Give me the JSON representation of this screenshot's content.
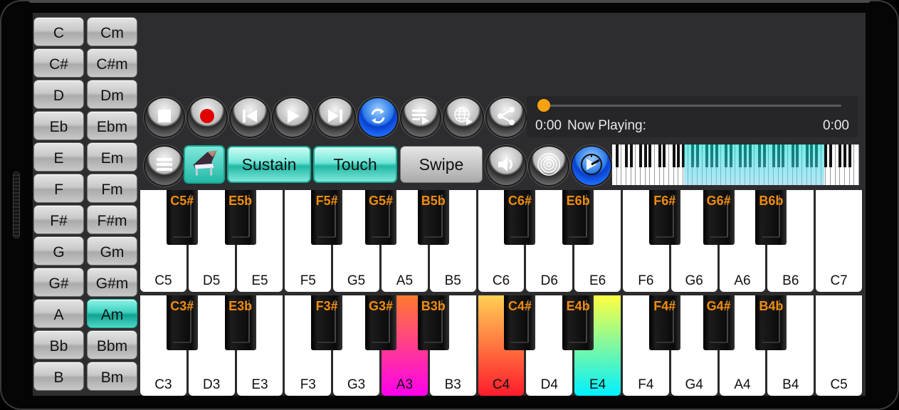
{
  "chords": [
    {
      "label": "C",
      "active": false
    },
    {
      "label": "Cm",
      "active": false
    },
    {
      "label": "C#",
      "active": false
    },
    {
      "label": "C#m",
      "active": false
    },
    {
      "label": "D",
      "active": false
    },
    {
      "label": "Dm",
      "active": false
    },
    {
      "label": "Eb",
      "active": false
    },
    {
      "label": "Ebm",
      "active": false
    },
    {
      "label": "E",
      "active": false
    },
    {
      "label": "Em",
      "active": false
    },
    {
      "label": "F",
      "active": false
    },
    {
      "label": "Fm",
      "active": false
    },
    {
      "label": "F#",
      "active": false
    },
    {
      "label": "F#m",
      "active": false
    },
    {
      "label": "G",
      "active": false
    },
    {
      "label": "Gm",
      "active": false
    },
    {
      "label": "G#",
      "active": false
    },
    {
      "label": "G#m",
      "active": false
    },
    {
      "label": "A",
      "active": false
    },
    {
      "label": "Am",
      "active": true
    },
    {
      "label": "Bb",
      "active": false
    },
    {
      "label": "Bbm",
      "active": false
    },
    {
      "label": "B",
      "active": false
    },
    {
      "label": "Bm",
      "active": false
    }
  ],
  "transport": [
    {
      "name": "stop",
      "icon": "stop-icon"
    },
    {
      "name": "record",
      "icon": "record-icon"
    },
    {
      "name": "previous",
      "icon": "skip-previous-icon"
    },
    {
      "name": "play",
      "icon": "play-icon"
    },
    {
      "name": "next",
      "icon": "skip-next-icon"
    },
    {
      "name": "loop",
      "icon": "repeat-icon",
      "highlight": true
    },
    {
      "name": "playlist",
      "icon": "playlist-icon"
    },
    {
      "name": "online-songs",
      "icon": "globe-play-icon"
    },
    {
      "name": "share",
      "icon": "share-icon"
    }
  ],
  "toolbar": {
    "menu_icon": "menu-icon",
    "instrument_icon": "grand-piano-icon",
    "sustain_label": "Sustain",
    "sustain_on": true,
    "touch_label": "Touch",
    "touch_on": true,
    "swipe_label": "Swipe",
    "swipe_on": false,
    "volume_icon": "volume-icon",
    "reverb_icon": "reverb-icon",
    "tempo_icon": "metronome-icon"
  },
  "player": {
    "elapsed": "0:00",
    "now_playing_label": "Now Playing:",
    "now_playing_title": "",
    "duration": "0:00",
    "progress": 0,
    "thumb_color": "#f7a10e"
  },
  "mini_keyboard": {
    "white_keys": 52,
    "visible_range_start_fraction": 0.29,
    "visible_range_end_fraction": 0.86
  },
  "keyboard_upper": {
    "white_keys": [
      "C5",
      "D5",
      "E5",
      "F5",
      "G5",
      "A5",
      "B5",
      "C6",
      "D6",
      "E6",
      "F6",
      "G6",
      "A6",
      "B6",
      "C7"
    ],
    "black_keys": [
      {
        "label": "C5#",
        "after": 0
      },
      {
        "label": "E5b",
        "after": 1
      },
      {
        "label": "F5#",
        "after": 3
      },
      {
        "label": "G5#",
        "after": 4
      },
      {
        "label": "B5b",
        "after": 5
      },
      {
        "label": "C6#",
        "after": 7
      },
      {
        "label": "E6b",
        "after": 8
      },
      {
        "label": "F6#",
        "after": 10
      },
      {
        "label": "G6#",
        "after": 11
      },
      {
        "label": "B6b",
        "after": 12
      }
    ],
    "highlighted": []
  },
  "keyboard_lower": {
    "white_keys": [
      "C3",
      "D3",
      "E3",
      "F3",
      "G3",
      "A3",
      "B3",
      "C4",
      "D4",
      "E4",
      "F4",
      "G4",
      "A4",
      "B4",
      "C5"
    ],
    "black_keys": [
      {
        "label": "C3#",
        "after": 0
      },
      {
        "label": "E3b",
        "after": 1
      },
      {
        "label": "F3#",
        "after": 3
      },
      {
        "label": "G3#",
        "after": 4
      },
      {
        "label": "B3b",
        "after": 5
      },
      {
        "label": "C4#",
        "after": 7
      },
      {
        "label": "E4b",
        "after": 8
      },
      {
        "label": "F4#",
        "after": 10
      },
      {
        "label": "G4#",
        "after": 11
      },
      {
        "label": "B4b",
        "after": 12
      }
    ],
    "highlighted": [
      {
        "key": "A3",
        "gradient": [
          "#ff7a2e",
          "#ff00ee"
        ]
      },
      {
        "key": "C4",
        "gradient": [
          "#ffcf55",
          "#ff1c2c"
        ]
      },
      {
        "key": "E4",
        "gradient": [
          "#ffff40",
          "#00f0ff"
        ]
      }
    ]
  },
  "colors": {
    "accent_teal": "#22b8a5",
    "black_key_label": "#f08c0e",
    "background": "#2d2c2f"
  }
}
